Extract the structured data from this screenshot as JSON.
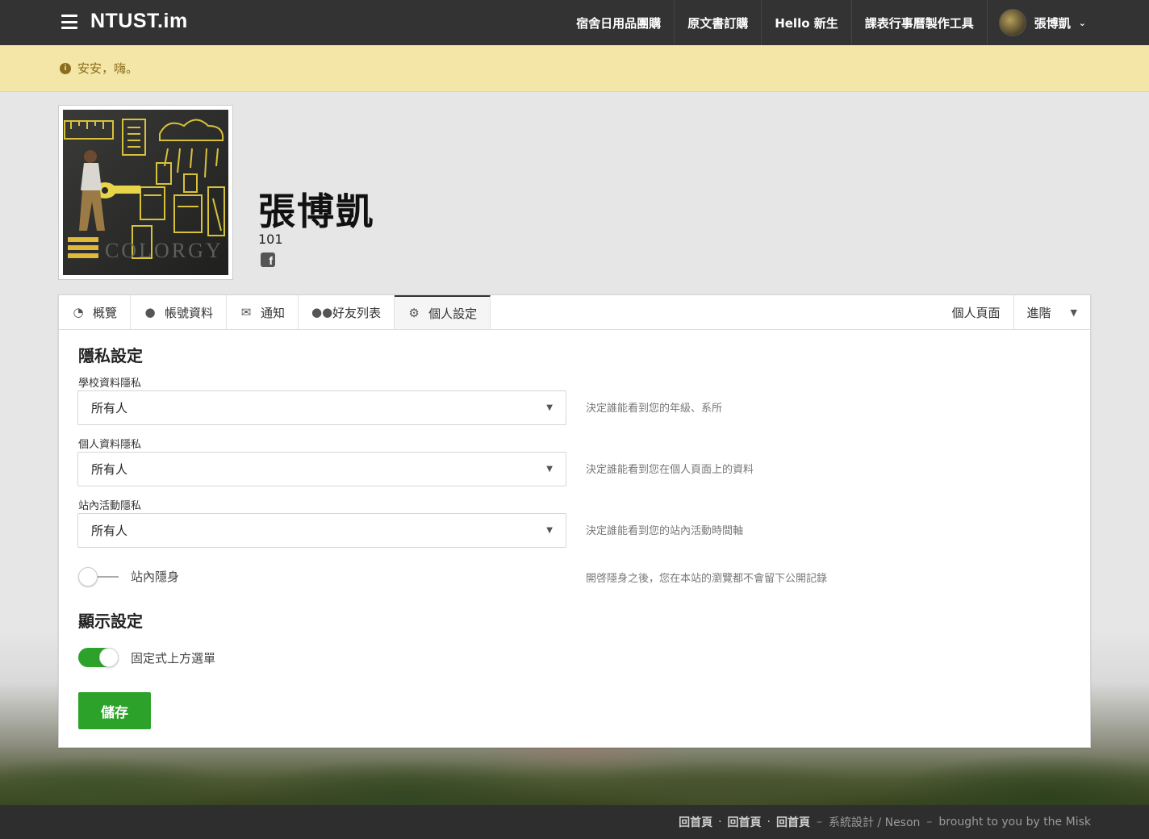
{
  "nav": {
    "brand": "NTUST.im",
    "links": [
      "宿舍日用品團購",
      "原文書訂購",
      "Hello 新生",
      "課表行事曆製作工具"
    ],
    "user_name": "張博凱"
  },
  "notice": {
    "text": "安安，嗨。"
  },
  "profile": {
    "name": "張博凱",
    "year": "101",
    "photo_sign": "COLORGY"
  },
  "tabs": {
    "items": [
      {
        "label": "概覽",
        "icon": "dashboard-icon"
      },
      {
        "label": "帳號資料",
        "icon": "user-icon"
      },
      {
        "label": "通知",
        "icon": "envelope-icon"
      },
      {
        "label": "好友列表",
        "icon": "users-icon"
      },
      {
        "label": "個人設定",
        "icon": "gears-icon"
      }
    ],
    "right": [
      "個人頁面",
      "進階"
    ]
  },
  "privacy": {
    "title": "隱私設定",
    "school": {
      "label": "學校資料隱私",
      "value": "所有人",
      "help": "決定誰能看到您的年級、系所"
    },
    "personal": {
      "label": "個人資料隱私",
      "value": "所有人",
      "help": "決定誰能看到您在個人頁面上的資料"
    },
    "activity": {
      "label": "站內活動隱私",
      "value": "所有人",
      "help": "決定誰能看到您的站內活動時間軸"
    },
    "stealth": {
      "label": "站內隱身",
      "help": "開啓隱身之後，您在本站的瀏覽都不會留下公開記錄",
      "on": false
    }
  },
  "display": {
    "title": "顯示設定",
    "fixed_menu": {
      "label": "固定式上方選單",
      "on": true
    }
  },
  "save_label": "儲存",
  "footer": {
    "links": [
      "回首頁",
      "回首頁",
      "回首頁"
    ],
    "design": "系統設計 / Neson",
    "credit": "brought to you by the Misk"
  },
  "colors": {
    "accent": "#2da22a",
    "nav_bg": "#333333",
    "notice_bg": "#f4e6a6",
    "notice_text": "#8a6d1e"
  }
}
